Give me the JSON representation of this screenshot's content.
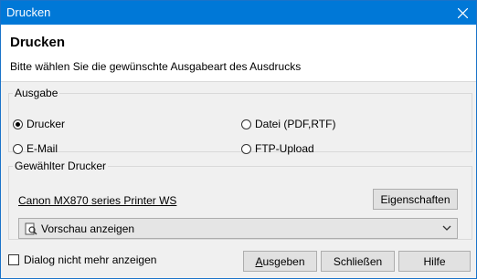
{
  "window": {
    "title": "Drucken"
  },
  "header": {
    "title": "Drucken",
    "subtitle": "Bitte wählen Sie die gewünschte Ausgabeart des Ausdrucks"
  },
  "output": {
    "legend": "Ausgabe",
    "options": [
      {
        "label": "Drucker",
        "selected": true
      },
      {
        "label": "Datei (PDF,RTF)",
        "selected": false
      },
      {
        "label": "E-Mail",
        "selected": false
      },
      {
        "label": "FTP-Upload",
        "selected": false
      }
    ]
  },
  "printer": {
    "legend": "Gewählter Drucker",
    "name": "Canon MX870 series Printer WS",
    "properties_label": "Eigenschaften",
    "preview_select": {
      "value": "Vorschau anzeigen",
      "icon": "preview-icon"
    }
  },
  "footer": {
    "checkbox_label": "Dialog nicht mehr anzeigen",
    "buttons": [
      "Ausgeben",
      "Schließen",
      "Hilfe"
    ]
  }
}
